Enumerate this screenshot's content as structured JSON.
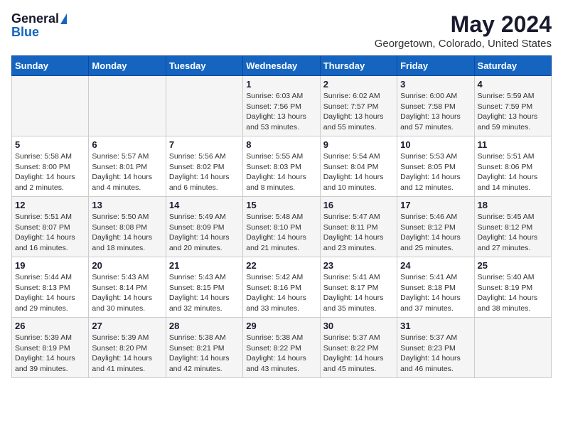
{
  "header": {
    "logo_general": "General",
    "logo_blue": "Blue",
    "month": "May 2024",
    "location": "Georgetown, Colorado, United States"
  },
  "weekdays": [
    "Sunday",
    "Monday",
    "Tuesday",
    "Wednesday",
    "Thursday",
    "Friday",
    "Saturday"
  ],
  "weeks": [
    [
      {
        "day": "",
        "info": ""
      },
      {
        "day": "",
        "info": ""
      },
      {
        "day": "",
        "info": ""
      },
      {
        "day": "1",
        "info": "Sunrise: 6:03 AM\nSunset: 7:56 PM\nDaylight: 13 hours and 53 minutes."
      },
      {
        "day": "2",
        "info": "Sunrise: 6:02 AM\nSunset: 7:57 PM\nDaylight: 13 hours and 55 minutes."
      },
      {
        "day": "3",
        "info": "Sunrise: 6:00 AM\nSunset: 7:58 PM\nDaylight: 13 hours and 57 minutes."
      },
      {
        "day": "4",
        "info": "Sunrise: 5:59 AM\nSunset: 7:59 PM\nDaylight: 13 hours and 59 minutes."
      }
    ],
    [
      {
        "day": "5",
        "info": "Sunrise: 5:58 AM\nSunset: 8:00 PM\nDaylight: 14 hours and 2 minutes."
      },
      {
        "day": "6",
        "info": "Sunrise: 5:57 AM\nSunset: 8:01 PM\nDaylight: 14 hours and 4 minutes."
      },
      {
        "day": "7",
        "info": "Sunrise: 5:56 AM\nSunset: 8:02 PM\nDaylight: 14 hours and 6 minutes."
      },
      {
        "day": "8",
        "info": "Sunrise: 5:55 AM\nSunset: 8:03 PM\nDaylight: 14 hours and 8 minutes."
      },
      {
        "day": "9",
        "info": "Sunrise: 5:54 AM\nSunset: 8:04 PM\nDaylight: 14 hours and 10 minutes."
      },
      {
        "day": "10",
        "info": "Sunrise: 5:53 AM\nSunset: 8:05 PM\nDaylight: 14 hours and 12 minutes."
      },
      {
        "day": "11",
        "info": "Sunrise: 5:51 AM\nSunset: 8:06 PM\nDaylight: 14 hours and 14 minutes."
      }
    ],
    [
      {
        "day": "12",
        "info": "Sunrise: 5:51 AM\nSunset: 8:07 PM\nDaylight: 14 hours and 16 minutes."
      },
      {
        "day": "13",
        "info": "Sunrise: 5:50 AM\nSunset: 8:08 PM\nDaylight: 14 hours and 18 minutes."
      },
      {
        "day": "14",
        "info": "Sunrise: 5:49 AM\nSunset: 8:09 PM\nDaylight: 14 hours and 20 minutes."
      },
      {
        "day": "15",
        "info": "Sunrise: 5:48 AM\nSunset: 8:10 PM\nDaylight: 14 hours and 21 minutes."
      },
      {
        "day": "16",
        "info": "Sunrise: 5:47 AM\nSunset: 8:11 PM\nDaylight: 14 hours and 23 minutes."
      },
      {
        "day": "17",
        "info": "Sunrise: 5:46 AM\nSunset: 8:12 PM\nDaylight: 14 hours and 25 minutes."
      },
      {
        "day": "18",
        "info": "Sunrise: 5:45 AM\nSunset: 8:12 PM\nDaylight: 14 hours and 27 minutes."
      }
    ],
    [
      {
        "day": "19",
        "info": "Sunrise: 5:44 AM\nSunset: 8:13 PM\nDaylight: 14 hours and 29 minutes."
      },
      {
        "day": "20",
        "info": "Sunrise: 5:43 AM\nSunset: 8:14 PM\nDaylight: 14 hours and 30 minutes."
      },
      {
        "day": "21",
        "info": "Sunrise: 5:43 AM\nSunset: 8:15 PM\nDaylight: 14 hours and 32 minutes."
      },
      {
        "day": "22",
        "info": "Sunrise: 5:42 AM\nSunset: 8:16 PM\nDaylight: 14 hours and 33 minutes."
      },
      {
        "day": "23",
        "info": "Sunrise: 5:41 AM\nSunset: 8:17 PM\nDaylight: 14 hours and 35 minutes."
      },
      {
        "day": "24",
        "info": "Sunrise: 5:41 AM\nSunset: 8:18 PM\nDaylight: 14 hours and 37 minutes."
      },
      {
        "day": "25",
        "info": "Sunrise: 5:40 AM\nSunset: 8:19 PM\nDaylight: 14 hours and 38 minutes."
      }
    ],
    [
      {
        "day": "26",
        "info": "Sunrise: 5:39 AM\nSunset: 8:19 PM\nDaylight: 14 hours and 39 minutes."
      },
      {
        "day": "27",
        "info": "Sunrise: 5:39 AM\nSunset: 8:20 PM\nDaylight: 14 hours and 41 minutes."
      },
      {
        "day": "28",
        "info": "Sunrise: 5:38 AM\nSunset: 8:21 PM\nDaylight: 14 hours and 42 minutes."
      },
      {
        "day": "29",
        "info": "Sunrise: 5:38 AM\nSunset: 8:22 PM\nDaylight: 14 hours and 43 minutes."
      },
      {
        "day": "30",
        "info": "Sunrise: 5:37 AM\nSunset: 8:22 PM\nDaylight: 14 hours and 45 minutes."
      },
      {
        "day": "31",
        "info": "Sunrise: 5:37 AM\nSunset: 8:23 PM\nDaylight: 14 hours and 46 minutes."
      },
      {
        "day": "",
        "info": ""
      }
    ]
  ]
}
